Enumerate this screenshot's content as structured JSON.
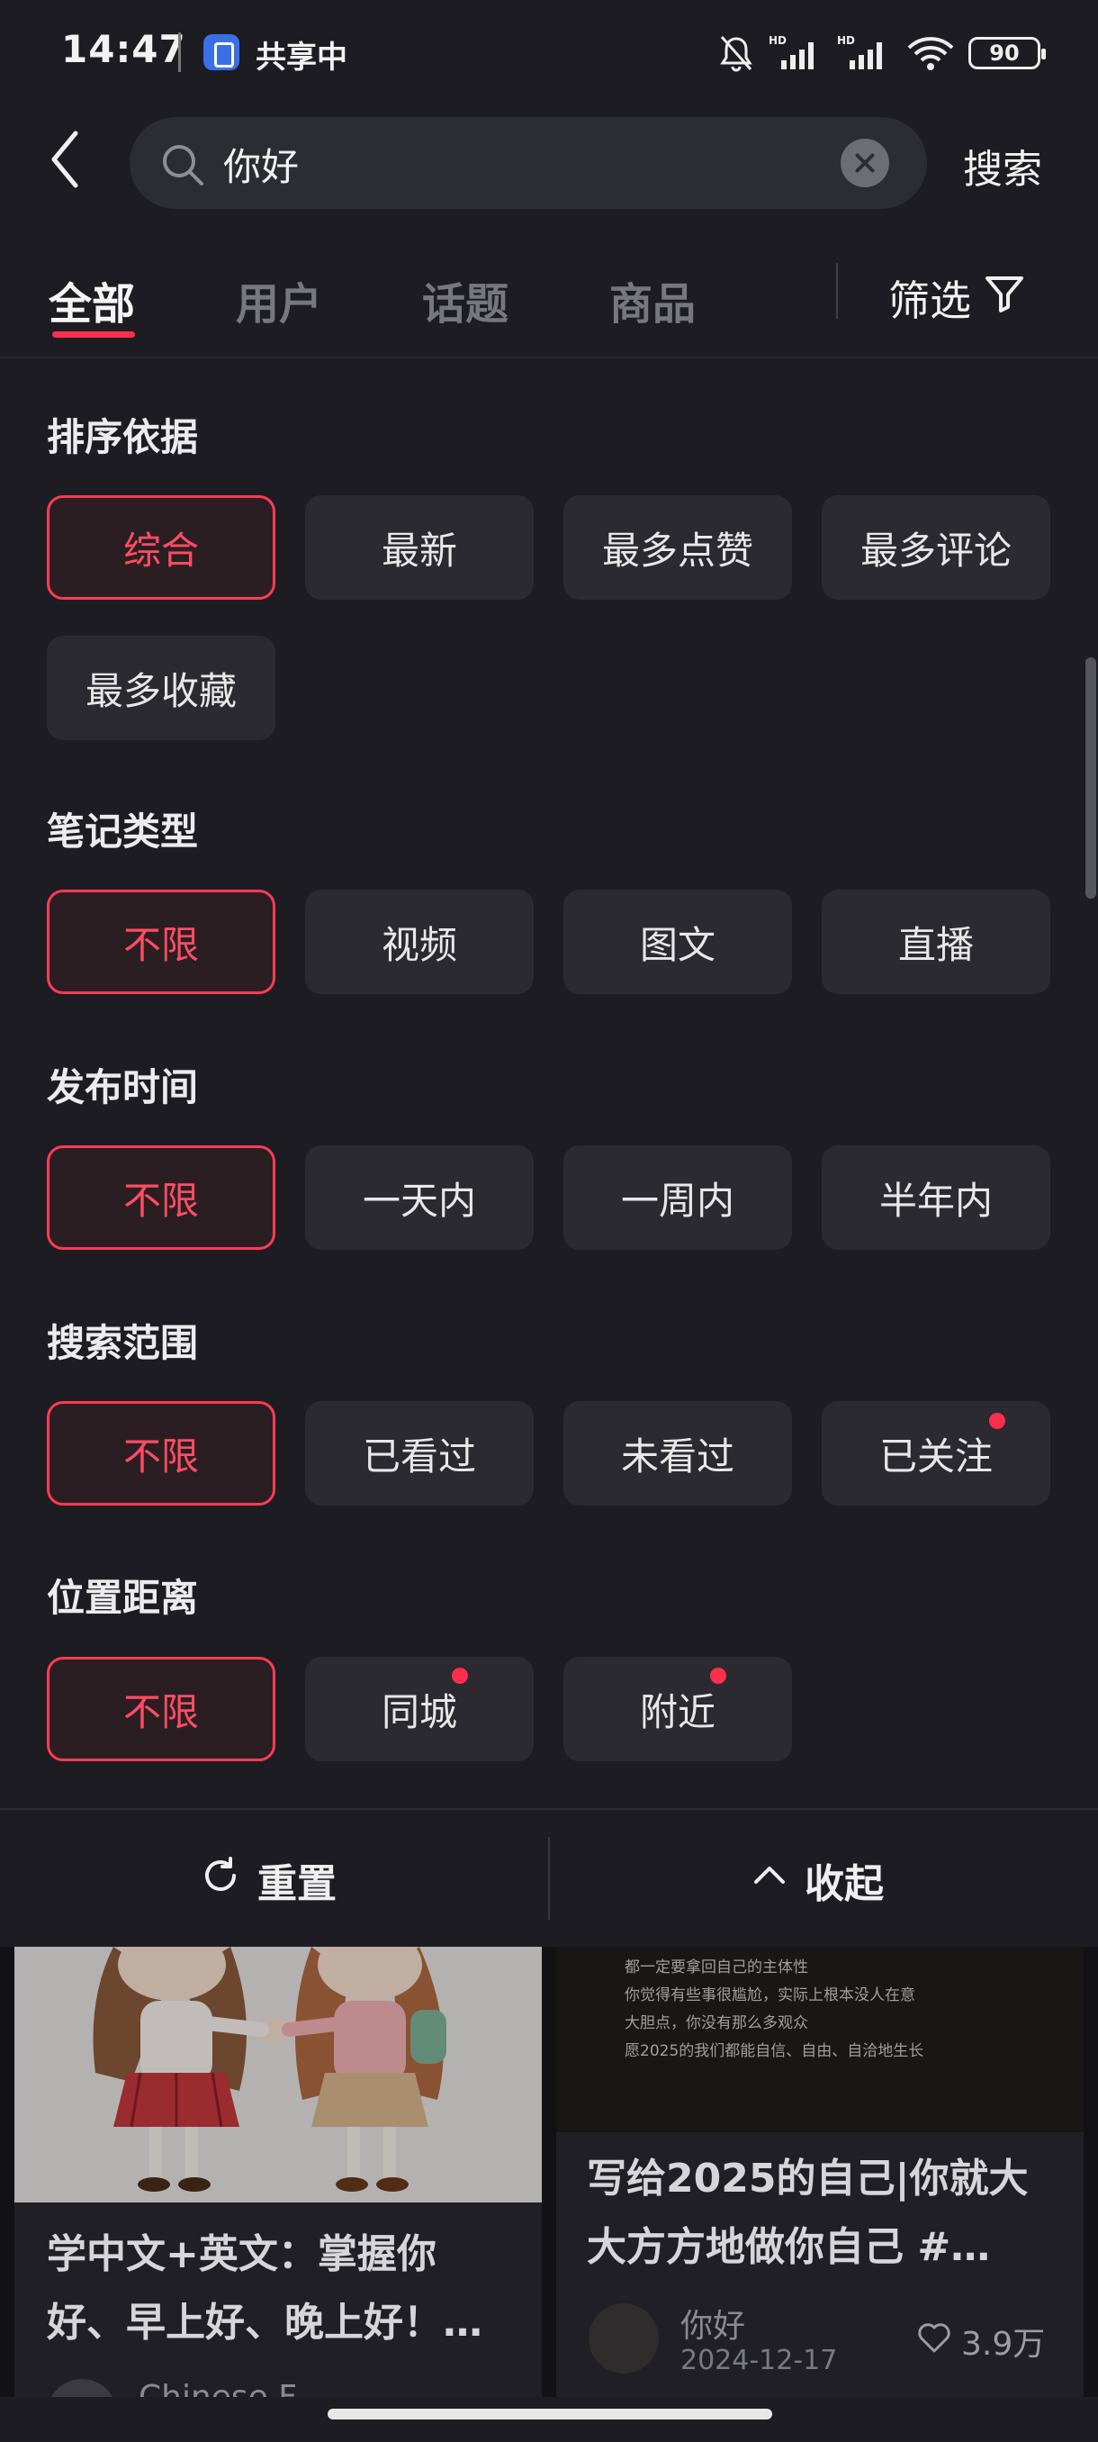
{
  "status_bar": {
    "time": "14:47",
    "share_label": "共享中",
    "battery": "90"
  },
  "search": {
    "query": "你好",
    "submit_label": "搜索"
  },
  "tabs": [
    {
      "label": "全部",
      "active": true
    },
    {
      "label": "用户",
      "active": false
    },
    {
      "label": "话题",
      "active": false
    },
    {
      "label": "商品",
      "active": false
    }
  ],
  "filter_button": {
    "label": "筛选"
  },
  "filters": {
    "sort": {
      "title": "排序依据",
      "options": [
        "综合",
        "最新",
        "最多点赞",
        "最多评论",
        "最多收藏"
      ],
      "selected": "综合"
    },
    "note_type": {
      "title": "笔记类型",
      "options": [
        "不限",
        "视频",
        "图文",
        "直播"
      ],
      "selected": "不限"
    },
    "publish_time": {
      "title": "发布时间",
      "options": [
        "不限",
        "一天内",
        "一周内",
        "半年内"
      ],
      "selected": "不限"
    },
    "search_scope": {
      "title": "搜索范围",
      "options": [
        "不限",
        "已看过",
        "未看过",
        "已关注"
      ],
      "selected": "不限",
      "new_badge": [
        "已关注"
      ]
    },
    "distance": {
      "title": "位置距离",
      "options": [
        "不限",
        "同城",
        "附近"
      ],
      "selected": "不限",
      "new_badge": [
        "同城",
        "附近"
      ]
    }
  },
  "actions": {
    "reset_label": "重置",
    "collapse_label": "收起"
  },
  "feed": {
    "card1": {
      "title_line1": "学中文+英文：掌握你",
      "title_line2": "好、早上好、晚上好！…",
      "author": "Chinese F"
    },
    "card2": {
      "quote_lines": [
        "都一定要拿回自己的主体性",
        "你觉得有些事很尴尬，实际上根本没人在意",
        "大胆点，你没有那么多观众",
        "愿2025的我们都能自信、自由、自洽地生长"
      ],
      "title_line1": "写给2025的自己|你就大",
      "title_line2": "大方方地做你自己 #…",
      "author": "你好",
      "date": "2024-12-17",
      "likes": "3.9万"
    }
  },
  "colors": {
    "accent": "#ff3b55",
    "background": "#1c1c22",
    "chip": "#2a2a30"
  }
}
